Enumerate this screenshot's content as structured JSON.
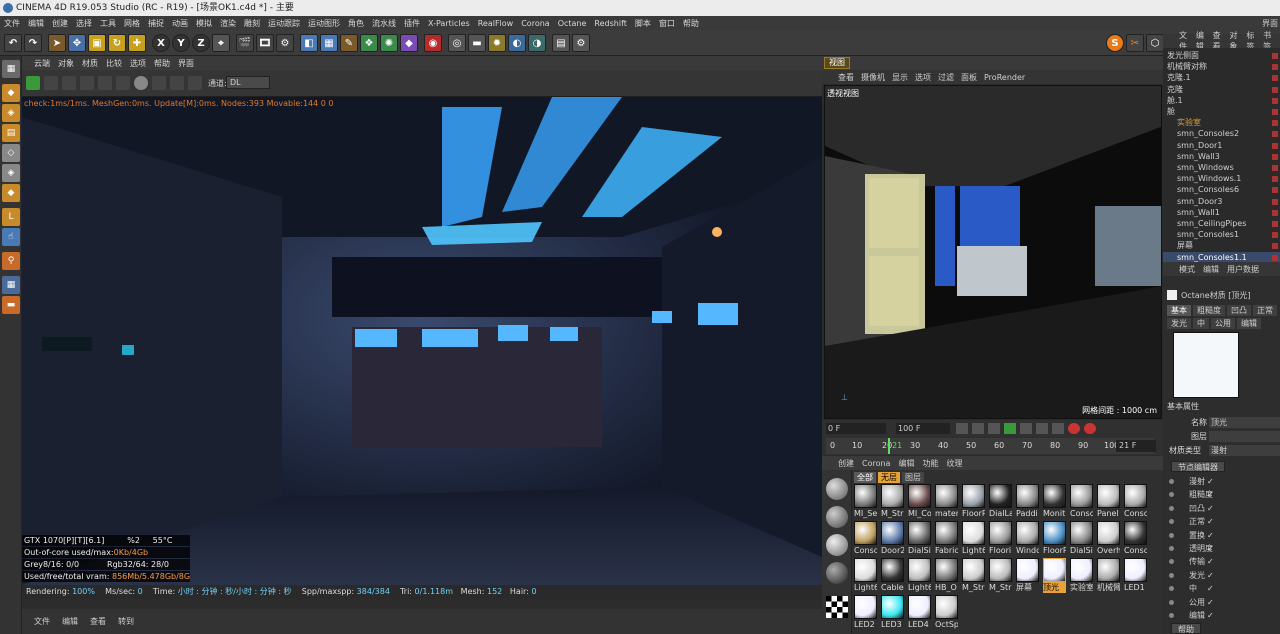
{
  "title": "CINEMA 4D R19.053 Studio (RC - R19) - [场景OK1.c4d *] - 主要",
  "corner_label": "界面",
  "menu": [
    "文件",
    "编辑",
    "创建",
    "选择",
    "工具",
    "网格",
    "捕捉",
    "动画",
    "模拟",
    "渲染",
    "雕刻",
    "运动跟踪",
    "运动图形",
    "角色",
    "流水线",
    "插件",
    "X-Particles",
    "RealFlow",
    "Corona",
    "Octane",
    "Redshift",
    "脚本",
    "窗口",
    "帮助"
  ],
  "toolbar_axes": [
    "X",
    "Y",
    "Z"
  ],
  "viewport_menu": [
    "云端",
    "对象",
    "材质",
    "比较",
    "选项",
    "帮助",
    "界面"
  ],
  "channel_label": "通道:",
  "channel_value": "DL",
  "render_overlay": "check:1ms/1ms. MeshGen:0ms. Update[M]:0ms. Nodes:393 Movable:144 0 0",
  "gpu": [
    {
      "label": "GTX 1070[P][T][6.1]",
      "a": "%2",
      "b": "55°C"
    },
    {
      "label": "Out-of-core used/max:",
      "a": "0Kb/4Gb"
    },
    {
      "label": "Grey8/16: 0/0",
      "b": "Rgb32/64: 28/0"
    },
    {
      "label": "Used/free/total vram: ",
      "a": "856Mb/5.478Gb/8Gb"
    }
  ],
  "status": {
    "rendering_label": "Rendering:",
    "rendering": "100%",
    "mss_label": "Ms/sec:",
    "mss": "0",
    "time_label": "Time:",
    "time": "小时 : 分钟 : 秒/小时 : 分钟 : 秒",
    "spp_label": "Spp/maxspp:",
    "spp": "384/384",
    "tri_label": "Tri:",
    "tri": "0/1.118m",
    "mesh_label": "Mesh:",
    "mesh": "152",
    "hair_label": "Hair:",
    "hair": "0"
  },
  "bottom_menu": [
    "文件",
    "编辑",
    "查看",
    "转到"
  ],
  "dim_tab": "视图",
  "vp2_menu": [
    "查看",
    "摄像机",
    "显示",
    "选项",
    "过滤",
    "面板",
    "ProRender"
  ],
  "vp2_label": "透视视图",
  "vp2_grid": "网格间距 : 1000 cm",
  "timeline": {
    "start": "0 F",
    "end": "100 F",
    "field": "0 F",
    "current": "21 F",
    "ticks": [
      "0",
      "10",
      "20",
      "21",
      "30",
      "40",
      "50",
      "60",
      "70",
      "80",
      "90",
      "100"
    ]
  },
  "mat_menu": [
    "创建",
    "Corona",
    "编辑",
    "功能",
    "纹理"
  ],
  "mat_tabs": [
    "全部",
    "无层",
    "图层"
  ],
  "materials": [
    "MI_Se",
    "M_Stri",
    "MI_Co",
    "mater",
    "FloorP",
    "DialLa",
    "Paddi",
    "Monit",
    "Consc",
    "Panel",
    "Consc",
    "Consc",
    "Door2",
    "DialSi",
    "Fabric",
    "Light6",
    "Floori",
    "Windc",
    "FloorP",
    "DialSi",
    "Overh",
    "Consc",
    "Light6",
    "Cable",
    "Light6",
    "HB_O",
    "M_Stri",
    "M_Stri",
    "屏幕",
    "顶光",
    "实验室",
    "机械臂",
    "LED1",
    "LED2",
    "LED3",
    "LED4",
    "OctSp"
  ],
  "right_menu": [
    "文件",
    "编辑",
    "查看",
    "对象",
    "标签",
    "书签"
  ],
  "objects": [
    "发光侧面",
    "机械臂对称",
    "克隆.1",
    "克隆",
    "舱.1",
    "舱",
    "实验室",
    "smn_Consoles2",
    "smn_Door1",
    "smn_Wall3",
    "smn_Windows",
    "smn_Windows.1",
    "smn_Consoles6",
    "smn_Door3",
    "smn_Wall1",
    "smn_CeilingPipes",
    "smn_Consoles1",
    "屏幕",
    "smn_Consoles1.1"
  ],
  "attr_menu": [
    "模式",
    "编辑",
    "用户数据"
  ],
  "attr_title": "Octane材质 [顶光]",
  "attr_tabs1": [
    "基本",
    "粗糙度",
    "凹凸",
    "正常"
  ],
  "attr_tabs2": [
    "发光",
    "中",
    "公用",
    "编辑"
  ],
  "basic_props": "基本属性",
  "name_label": "名称",
  "name_value": "顶光",
  "layer_label": "图层",
  "layer_value": "",
  "mat_type_label": "材质类型",
  "mat_type_value": "漫射",
  "node_editor": "节点编辑器",
  "channels": [
    {
      "name": "漫射",
      "on": "✓"
    },
    {
      "name": "粗糙度",
      "on": "✓"
    },
    {
      "name": "凹凸",
      "on": "✓"
    },
    {
      "name": "正常",
      "on": "✓"
    },
    {
      "name": "置换",
      "on": "✓"
    },
    {
      "name": "透明度",
      "on": "✓"
    },
    {
      "name": "传输",
      "on": "✓"
    },
    {
      "name": "发光",
      "on": "✓"
    },
    {
      "name": "中",
      "on": "✓"
    },
    {
      "name": "公用",
      "on": "✓"
    },
    {
      "name": "编辑",
      "on": "✓"
    }
  ],
  "help": "帮助"
}
